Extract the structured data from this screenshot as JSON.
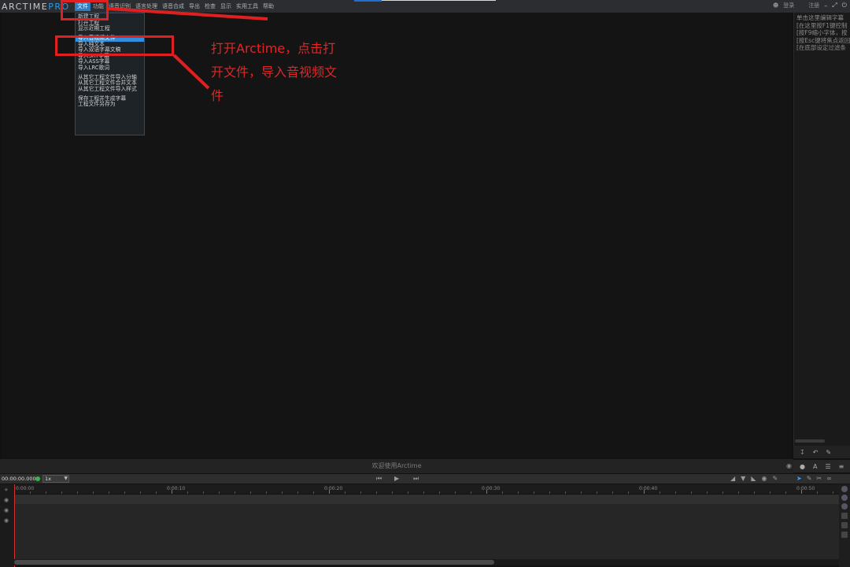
{
  "app": {
    "logo_main": "ARCTIME",
    "logo_pro": "PRO"
  },
  "menubar": {
    "items": [
      "文件",
      "功能",
      "语音识别",
      "语言处理",
      "语音合成",
      "导出",
      "检查",
      "显示",
      "实用工具",
      "帮助"
    ]
  },
  "window": {
    "login": "登录",
    "register": "注册"
  },
  "file_menu": {
    "items": [
      "新建工程",
      "打开工程",
      "显示近期工程",
      "导入音视频文件",
      "导入纯文本",
      "导入双语字幕文稿",
      "导入SRT字幕",
      "导入ASS字幕",
      "导入LRC歌词",
      "从其它工程文件导入分轴",
      "从其它工程文件合并文本",
      "从其它工程文件导入样式",
      "保存工程并生成字幕",
      "工程文件另存为"
    ],
    "highlighted_index": 3
  },
  "side_panel": {
    "lines": [
      "单击这里编辑字幕",
      "[在这里按F1键控制",
      "[按F9缩小字体，按",
      "[按Esc键将焦点返回",
      "[在底部设定过滤条"
    ]
  },
  "welcome": {
    "text": "欢迎使用Arctime"
  },
  "transport": {
    "timecode": "00:00:00.000",
    "speed": "1x"
  },
  "timeline": {
    "labels": [
      "0:00:00",
      "0:00:10",
      "0:00:20",
      "0:00:30",
      "0:00:40",
      "0:00:50"
    ]
  },
  "annotation": {
    "text": "打开Arctime，点击打开文件，导入音视频文件",
    "color": "#e02020"
  },
  "colors": {
    "accent": "#2f8fe0",
    "playhead": "#d43030",
    "record": "#3ab54a"
  }
}
